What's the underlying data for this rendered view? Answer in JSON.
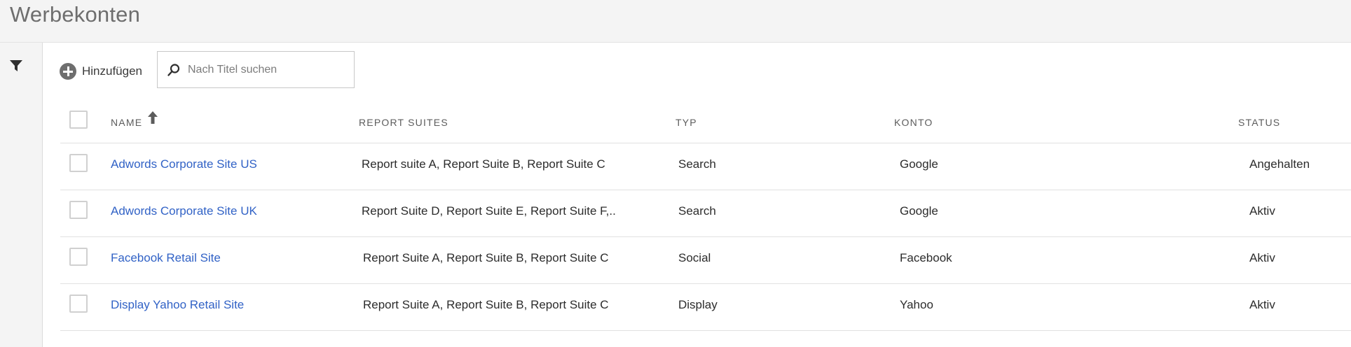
{
  "page": {
    "title": "Werbekonten"
  },
  "toolbar": {
    "add_label": "Hinzufügen",
    "search_placeholder": "Nach Titel suchen",
    "search_value": ""
  },
  "table": {
    "columns": {
      "name": "NAME",
      "report_suites": "REPORT SUITES",
      "type": "TYP",
      "account": "KONTO",
      "status": "STATUS"
    },
    "sort": {
      "column": "name",
      "direction": "ascending"
    },
    "rows": [
      {
        "name": "Adwords Corporate Site US",
        "report_suites": "Report suite A, Report Suite B, Report Suite C",
        "type": "Search",
        "account": "Google",
        "status": "Angehalten"
      },
      {
        "name": "Adwords Corporate Site UK",
        "report_suites": "Report Suite D, Report Suite E, Report Suite F,..",
        "type": "Search",
        "account": "Google",
        "status": "Aktiv"
      },
      {
        "name": "Facebook Retail Site",
        "report_suites": "Report Suite A, Report Suite B, Report Suite C",
        "type": "Social",
        "account": "Facebook",
        "status": "Aktiv"
      },
      {
        "name": "Display Yahoo Retail Site",
        "report_suites": "Report Suite A, Report Suite B, Report Suite C",
        "type": "Display",
        "account": "Yahoo",
        "status": "Aktiv"
      }
    ]
  },
  "icons": {
    "filter": "filter-icon",
    "add": "add-circle-icon",
    "search": "search-icon",
    "sort": "arrow-up-icon"
  },
  "colors": {
    "link": "#3162c6",
    "header_bg": "#f4f4f4",
    "title": "#6e6e6e"
  }
}
